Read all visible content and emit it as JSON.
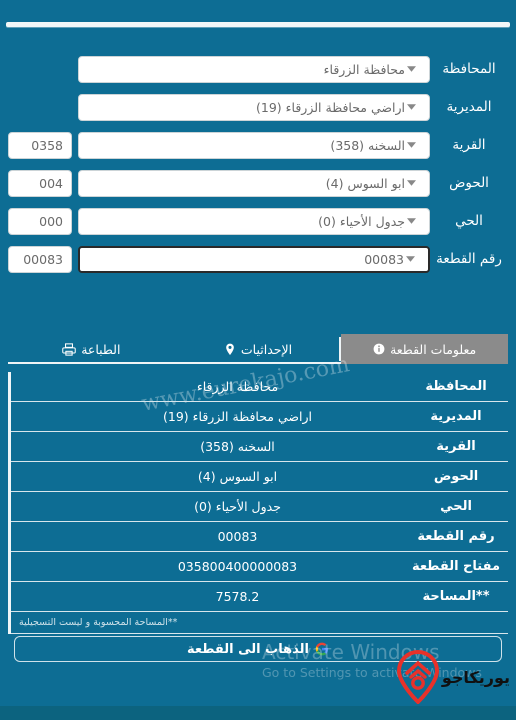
{
  "page": {
    "background_color": "#0d6d94",
    "direction": "rtl"
  },
  "form": {
    "rows": [
      {
        "label": "المحافظة",
        "value": "محافظة الزرقاء",
        "code": "",
        "has_code": false,
        "focused": false,
        "name": "governorate"
      },
      {
        "label": "المديرية",
        "value": "اراضي محافظة الزرقاء (19)",
        "code": "",
        "has_code": false,
        "focused": false,
        "name": "directorate"
      },
      {
        "label": "القرية",
        "value": "السخنه (358)",
        "code": "0358",
        "has_code": true,
        "focused": false,
        "name": "village"
      },
      {
        "label": "الحوض",
        "value": "ابو السوس (4)",
        "code": "004",
        "has_code": true,
        "focused": false,
        "name": "basin"
      },
      {
        "label": "الحي",
        "value": "جدول الأحياء (0)",
        "code": "000",
        "has_code": true,
        "focused": false,
        "name": "neighborhood"
      },
      {
        "label": "رقم القطعة",
        "value": "00083",
        "code": "00083",
        "has_code": true,
        "focused": true,
        "name": "parcel-number"
      }
    ]
  },
  "tabs": [
    {
      "label": "معلومات القطعة",
      "icon": "info-icon",
      "active": true,
      "name": "tab-parcel-info"
    },
    {
      "label": "الإحداثيات",
      "icon": "location-pin-icon",
      "active": false,
      "name": "tab-coordinates"
    },
    {
      "label": "الطباعة",
      "icon": "printer-icon",
      "active": false,
      "name": "tab-print"
    }
  ],
  "info_table": {
    "rows": [
      {
        "key": "المحافظة",
        "value": "محافظة الزرقاء"
      },
      {
        "key": "المديرية",
        "value": "اراضي محافظة الزرقاء (19)"
      },
      {
        "key": "القرية",
        "value": "السخنه (358)"
      },
      {
        "key": "الحوض",
        "value": "ابو السوس (4)"
      },
      {
        "key": "الحي",
        "value": "جدول الأحياء (0)"
      },
      {
        "key": "رقم القطعة",
        "value": "00083"
      },
      {
        "key": "مفتاح القطعة",
        "value": "035800400000083"
      },
      {
        "key": "**المساحة",
        "value": "7578.2"
      }
    ],
    "footnote": "**المساحة المحسوبة و ليست التسجيلية"
  },
  "go_button": {
    "label": "الذهاب الى القطعة",
    "icon": "google-icon"
  },
  "watermarks": {
    "site_url": "www.eurekajo.com",
    "activate_title": "Activate Windows",
    "activate_subtitle": "Go to Settings to activate Windows"
  },
  "brand": {
    "name": "يوريكاجو",
    "mark_color": "#e8312a"
  }
}
